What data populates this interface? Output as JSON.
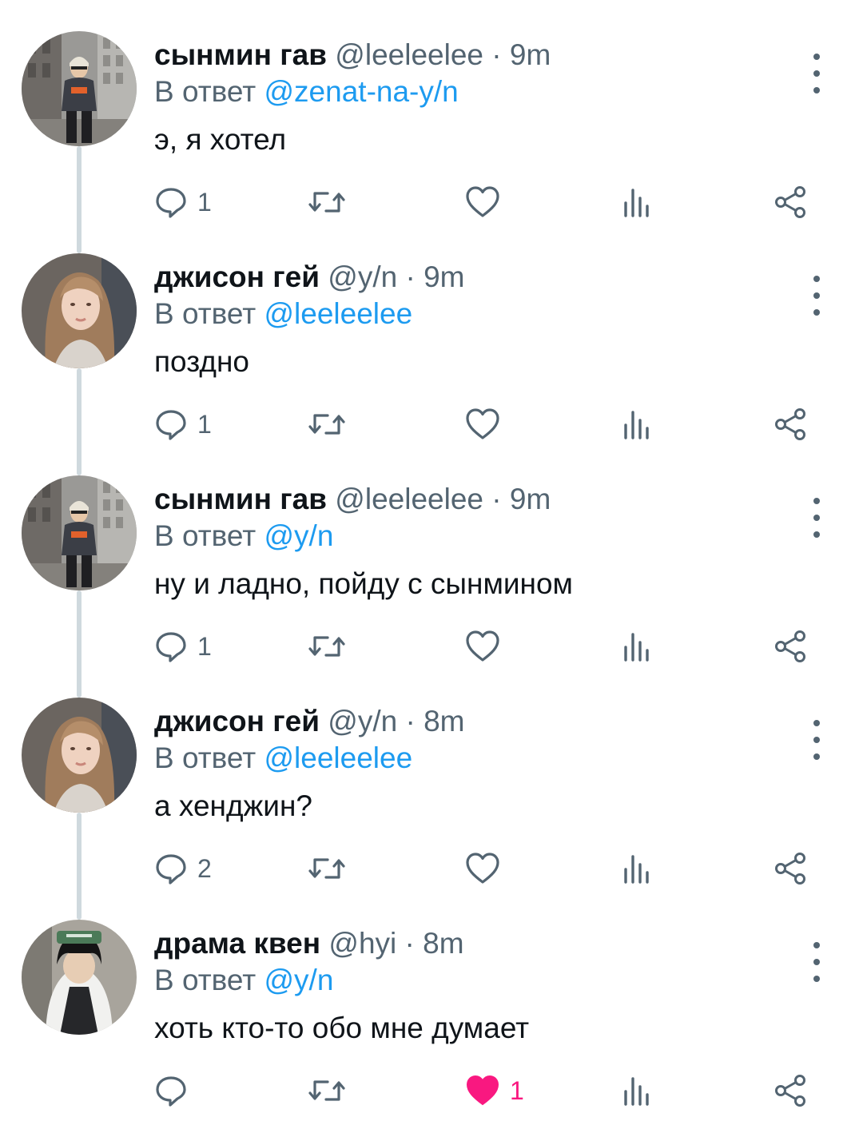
{
  "reply_prefix": "В ответ",
  "colors": {
    "link": "#1d9bf0",
    "secondary": "#536471",
    "like": "#f91880",
    "thread_line": "#cfd9de"
  },
  "tweets": [
    {
      "avatar": "avatar-street-man",
      "name": "сынмин гав",
      "handle": "@leeleelee",
      "dot": "·",
      "time": "9m",
      "reply_to": "@zenat-na-y/n",
      "text": "э, я хотел",
      "replies": "1",
      "likes": "",
      "liked": false
    },
    {
      "avatar": "avatar-girl",
      "name": "джисон гей",
      "handle": "@y/n",
      "dot": "·",
      "time": "9m",
      "reply_to": "@leeleelee",
      "text": "поздно",
      "replies": "1",
      "likes": "",
      "liked": false
    },
    {
      "avatar": "avatar-street-man",
      "name": "сынмин гав",
      "handle": "@leeleelee",
      "dot": "·",
      "time": "9m",
      "reply_to": "@y/n",
      "text": "ну и ладно, пойду с сынмином",
      "replies": "1",
      "likes": "",
      "liked": false
    },
    {
      "avatar": "avatar-girl",
      "name": "джисон гей",
      "handle": "@y/n",
      "dot": "·",
      "time": "8m",
      "reply_to": "@leeleelee",
      "text": "а хенджин?",
      "replies": "2",
      "likes": "",
      "liked": false
    },
    {
      "avatar": "avatar-cap-boy",
      "name": "драма квен",
      "handle": "@hyi",
      "dot": "·",
      "time": "8m",
      "reply_to": "@y/n",
      "text": "хоть кто-то обо мне думает",
      "replies": "",
      "likes": "1",
      "liked": true
    }
  ]
}
